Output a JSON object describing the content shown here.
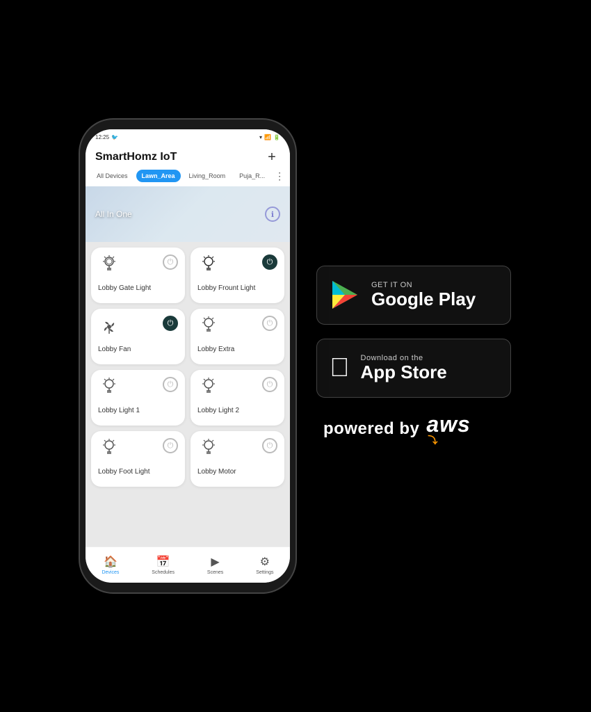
{
  "app": {
    "title": "SmartHomz IoT",
    "add_button": "+",
    "status_time": "12:25",
    "section_label": "All In One"
  },
  "tabs": [
    {
      "label": "All Devices",
      "active": false
    },
    {
      "label": "Lawn_Area",
      "active": true
    },
    {
      "label": "Living_Room",
      "active": false
    },
    {
      "label": "Puja_R...",
      "active": false
    }
  ],
  "devices": [
    {
      "name": "Lobby Gate Light",
      "icon": "light",
      "power": "off"
    },
    {
      "name": "Lobby Frount Light",
      "icon": "light",
      "power": "on"
    },
    {
      "name": "Lobby Fan",
      "icon": "fan",
      "power": "on"
    },
    {
      "name": "Lobby Extra",
      "icon": "light",
      "power": "off"
    },
    {
      "name": "Lobby Light 1",
      "icon": "light",
      "power": "off"
    },
    {
      "name": "Lobby Light 2",
      "icon": "light",
      "power": "off"
    },
    {
      "name": "Lobby Foot Light",
      "icon": "light",
      "power": "off"
    },
    {
      "name": "Lobby Motor",
      "icon": "light",
      "power": "off"
    }
  ],
  "nav": [
    {
      "label": "Devices",
      "icon": "🏠",
      "active": true
    },
    {
      "label": "Schedules",
      "icon": "📅",
      "active": false
    },
    {
      "label": "Scenes",
      "icon": "▶",
      "active": false
    },
    {
      "label": "Settings",
      "icon": "⚙",
      "active": false
    }
  ],
  "google_play": {
    "pre_text": "GET IT ON",
    "main_text": "Google Play"
  },
  "app_store": {
    "pre_text": "Download on the",
    "main_text": "App Store"
  },
  "aws": {
    "text": "powered by  aws"
  }
}
